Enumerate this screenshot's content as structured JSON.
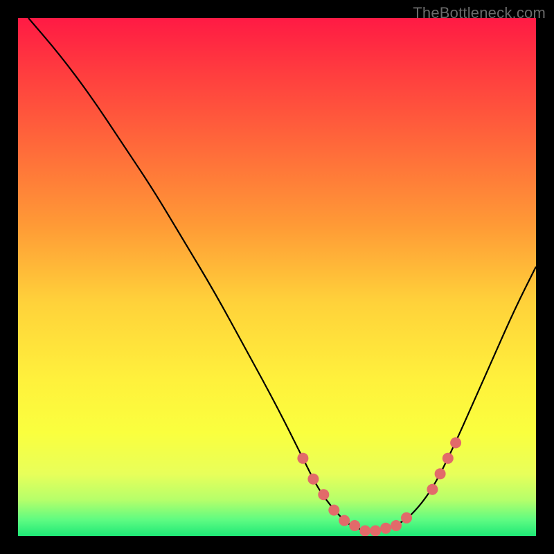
{
  "watermark": "TheBottleneck.com",
  "chart_data": {
    "type": "line",
    "title": "",
    "xlabel": "",
    "ylabel": "",
    "xlim": [
      0,
      100
    ],
    "ylim": [
      0,
      100
    ],
    "series": [
      {
        "name": "bottleneck-curve",
        "x": [
          2,
          8,
          14,
          20,
          26,
          32,
          38,
          44,
          50,
          55,
          58,
          61,
          64,
          67,
          70,
          73,
          76,
          80,
          84,
          88,
          92,
          96,
          100
        ],
        "y": [
          100,
          93,
          85,
          76,
          67,
          57,
          47,
          36,
          25,
          15,
          9,
          5,
          2,
          1,
          1,
          2,
          4,
          9,
          17,
          26,
          35,
          44,
          52
        ]
      }
    ],
    "markers": {
      "name": "highlight-dots",
      "x": [
        55,
        57,
        59,
        61,
        63,
        65,
        67,
        69,
        71,
        73,
        75,
        80,
        81.5,
        83,
        84.5
      ],
      "y": [
        15,
        11,
        8,
        5,
        3,
        2,
        1,
        1,
        1.5,
        2,
        3.5,
        9,
        12,
        15,
        18
      ]
    }
  }
}
